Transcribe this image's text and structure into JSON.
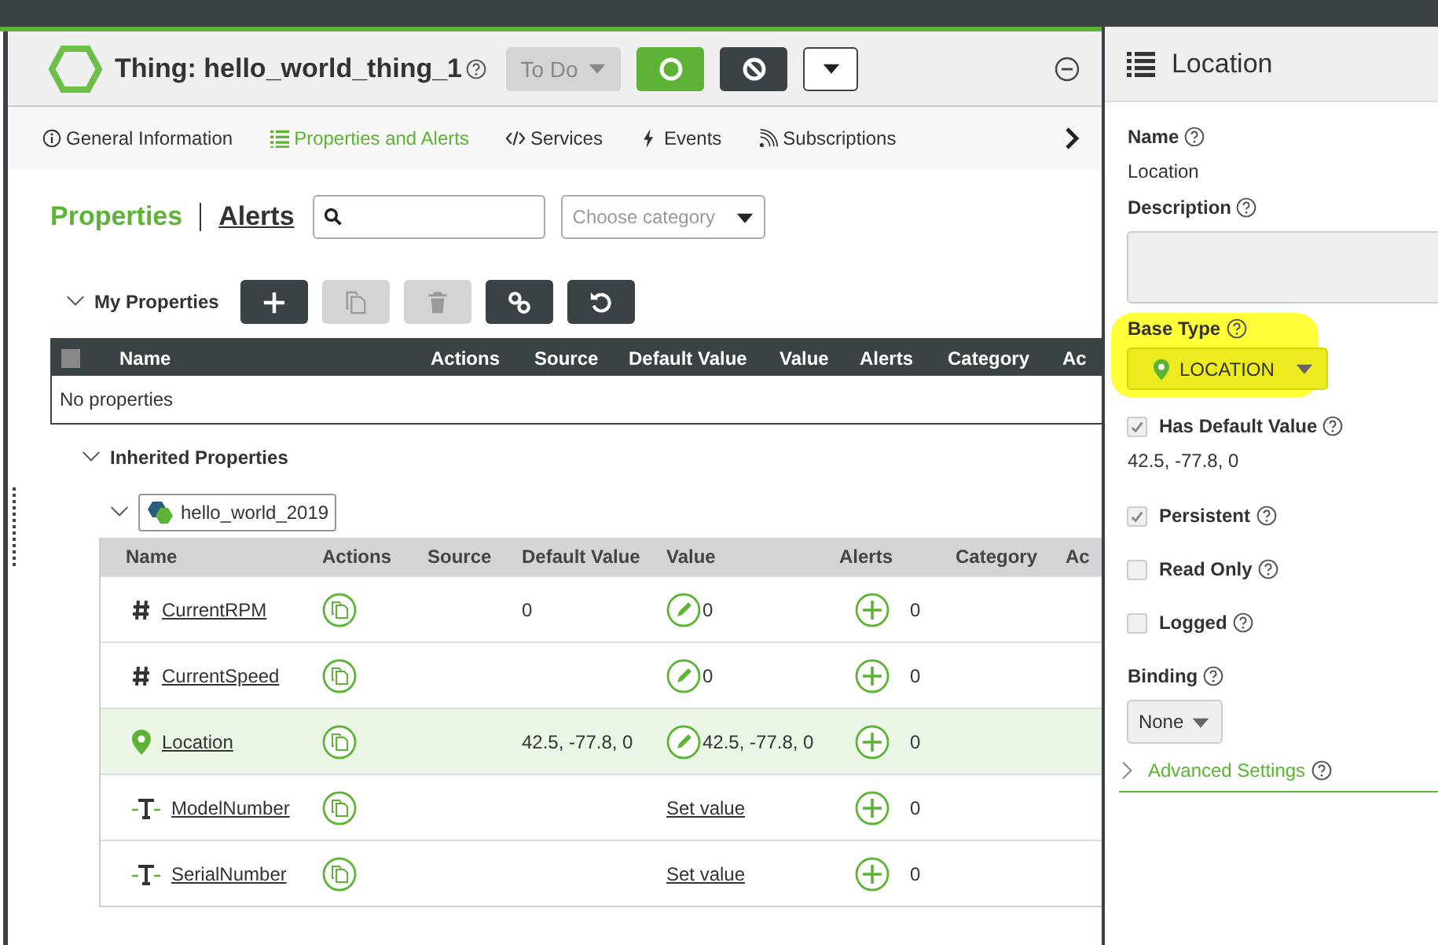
{
  "header": {
    "title": "Thing: hello_world_thing_1",
    "state": "To Do"
  },
  "tabs": [
    {
      "label": "General Information",
      "kind": "info",
      "selected": false
    },
    {
      "label": "Properties and Alerts",
      "kind": "list",
      "selected": true
    },
    {
      "label": "Services",
      "kind": "code",
      "selected": false
    },
    {
      "label": "Events",
      "kind": "event",
      "selected": false
    },
    {
      "label": "Subscriptions",
      "kind": "feed",
      "selected": false
    }
  ],
  "section_tabs": [
    {
      "label": "Properties",
      "selected": true
    },
    {
      "label": "Alerts",
      "selected": false
    }
  ],
  "category_select": {
    "placeholder": "Choose category"
  },
  "my_properties": {
    "title": "My Properties",
    "expanded": true,
    "select_all_checked": false,
    "toolbar": [
      {
        "kind": "add",
        "disabled": false
      },
      {
        "kind": "copy",
        "disabled": true
      },
      {
        "kind": "delete",
        "disabled": true
      },
      {
        "kind": "link",
        "disabled": false
      },
      {
        "kind": "reset",
        "disabled": false
      }
    ],
    "columns": [
      "Name",
      "Actions",
      "Source",
      "Default Value",
      "Value",
      "Alerts",
      "Category",
      "Ac"
    ],
    "empty_text": "No properties"
  },
  "inherited_properties": {
    "title": "Inherited Properties",
    "expanded": true,
    "source": {
      "name": "hello_world_2019",
      "expanded": true
    },
    "columns": [
      "Name",
      "Actions",
      "Source",
      "Default Value",
      "Value",
      "Alerts",
      "Category",
      "Ac"
    ],
    "rows": [
      {
        "kind": "number",
        "name": "CurrentRPM",
        "default_value": "0",
        "value": "0",
        "alerts": "0",
        "selected": false
      },
      {
        "kind": "number",
        "name": "CurrentSpeed",
        "value": "0",
        "alerts": "0",
        "selected": false
      },
      {
        "kind": "location",
        "name": "Location",
        "default_value": "42.5, -77.8, 0",
        "value": "42.5, -77.8, 0",
        "alerts": "0",
        "selected": true
      },
      {
        "kind": "string",
        "name": "ModelNumber",
        "set_value_link": "Set value",
        "alerts": "0",
        "selected": false
      },
      {
        "kind": "string",
        "name": "SerialNumber",
        "set_value_link": "Set value",
        "alerts": "0",
        "selected": false
      }
    ]
  },
  "panel": {
    "title": "Location",
    "fields": [
      {
        "kind": "label",
        "text": "Name"
      },
      {
        "kind": "text",
        "text": "Location"
      },
      {
        "kind": "label",
        "text": "Description"
      },
      {
        "kind": "textarea"
      },
      {
        "kind": "select",
        "label": "Base Type",
        "value": "LOCATION",
        "highlighted": true
      },
      {
        "kind": "checkbox",
        "label": "Has Default Value",
        "checked": true
      },
      {
        "kind": "text",
        "text": "42.5, -77.8, 0"
      },
      {
        "kind": "checkbox",
        "label": "Persistent",
        "checked": true
      },
      {
        "kind": "checkbox",
        "label": "Read Only",
        "checked": false
      },
      {
        "kind": "checkbox",
        "label": "Logged",
        "checked": false
      },
      {
        "kind": "label",
        "text": "Binding"
      },
      {
        "kind": "dropdown",
        "value": "None"
      },
      {
        "kind": "expander",
        "label": "Advanced Settings",
        "expanded": false
      }
    ]
  }
}
